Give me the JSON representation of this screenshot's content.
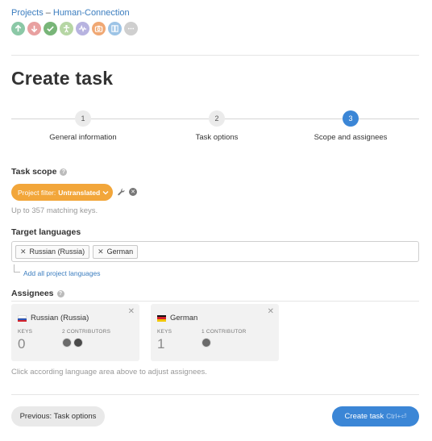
{
  "breadcrumb": {
    "projects": "Projects",
    "separator": "–",
    "project": "Human-Connection"
  },
  "toolbar_icons": [
    {
      "name": "upload-icon",
      "color": "#8bc8a6"
    },
    {
      "name": "download-icon",
      "color": "#e8a0a0"
    },
    {
      "name": "check-icon",
      "color": "#78b578"
    },
    {
      "name": "contributors-icon",
      "color": "#b6d6a4"
    },
    {
      "name": "activity-icon",
      "color": "#b7b3e0"
    },
    {
      "name": "screenshots-icon",
      "color": "#f0a874"
    },
    {
      "name": "book-icon",
      "color": "#9dc4e6"
    },
    {
      "name": "more-icon",
      "color": "#cfcfcf"
    }
  ],
  "page_title": "Create task",
  "steps": [
    {
      "number": "1",
      "label": "General information"
    },
    {
      "number": "2",
      "label": "Task options"
    },
    {
      "number": "3",
      "label": "Scope and assignees"
    }
  ],
  "scope": {
    "heading": "Task scope",
    "help": "?",
    "filter_prefix": "Project filter:",
    "filter_value": "Untranslated",
    "matching": "Up to 357 matching keys."
  },
  "target": {
    "heading": "Target languages",
    "chips": [
      "Russian (Russia)",
      "German"
    ],
    "add_all": "Add all project languages"
  },
  "assignees": {
    "heading": "Assignees",
    "help": "?",
    "cards": [
      {
        "language": "Russian (Russia)",
        "keys_label": "KEYS",
        "keys": "0",
        "contributors_label": "2 CONTRIBUTORS"
      },
      {
        "language": "German",
        "keys_label": "KEYS",
        "keys": "1",
        "contributors_label": "1 CONTRIBUTOR"
      }
    ],
    "hint": "Click according language area above to adjust assignees."
  },
  "buttons": {
    "previous": "Previous: Task options",
    "create": "Create task",
    "create_shortcut": "Ctrl+⏎"
  },
  "colors": {
    "accent": "#3b86d6",
    "filter": "#f2a63a",
    "link": "#3b7dbf"
  }
}
